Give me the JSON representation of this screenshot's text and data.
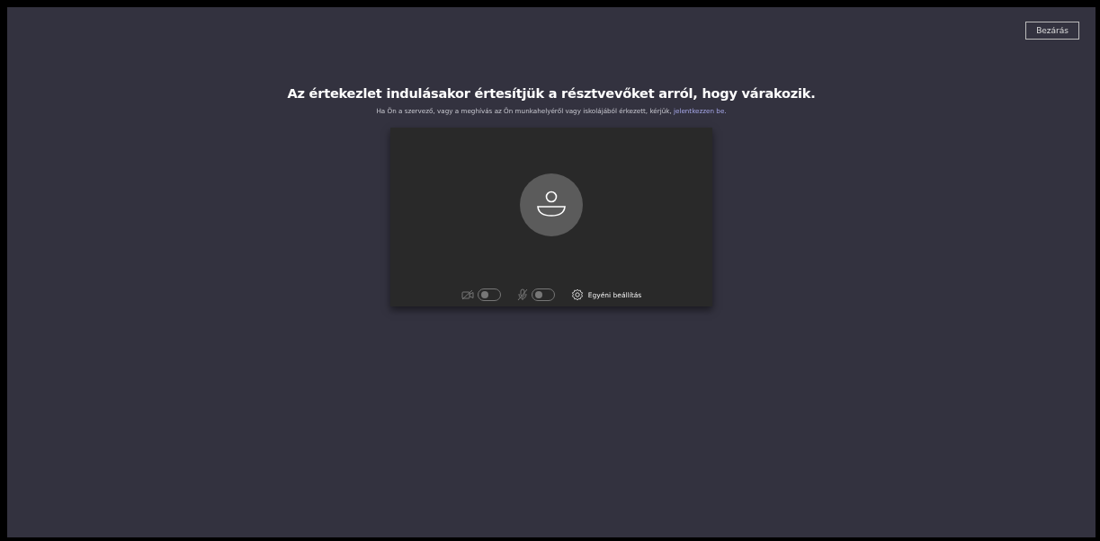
{
  "close_button": {
    "label": "Bezárás"
  },
  "heading": "Az értekezlet indulásakor értesítjük a résztvevőket arról, hogy várakozik.",
  "subtitle": {
    "text": "Ha Ön a szervező, vagy a meghívás az Ön munkahelyéről vagy iskolájából érkezett, kérjük, ",
    "link": "jelentkezzen be."
  },
  "preview": {
    "controls": [
      {
        "kind": "camera",
        "on": false
      },
      {
        "kind": "microphone",
        "on": false
      }
    ],
    "settings": {
      "label": "Egyéni beállítás"
    }
  }
}
